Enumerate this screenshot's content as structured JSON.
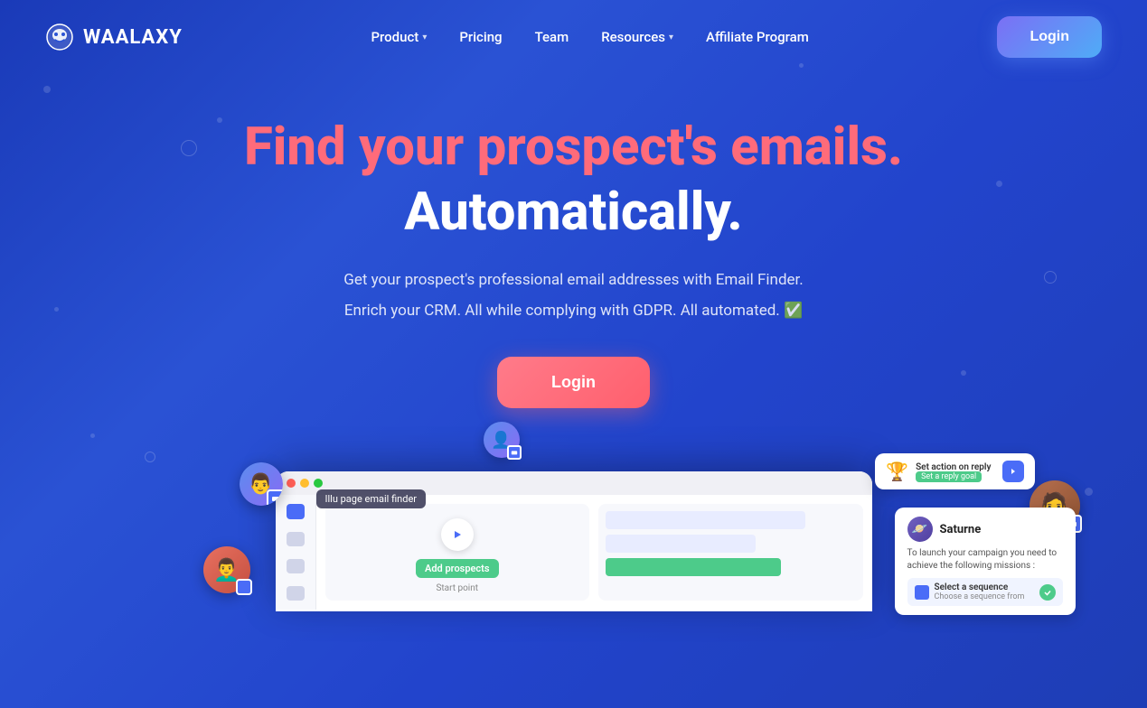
{
  "brand": {
    "name": "WAALAXY",
    "logo_icon": "👾"
  },
  "nav": {
    "items": [
      {
        "label": "Product",
        "has_dropdown": true
      },
      {
        "label": "Pricing",
        "has_dropdown": false
      },
      {
        "label": "Team",
        "has_dropdown": false
      },
      {
        "label": "Resources",
        "has_dropdown": true
      },
      {
        "label": "Affiliate Program",
        "has_dropdown": false
      }
    ],
    "login_label": "Login"
  },
  "hero": {
    "title_line1": "Find your prospect's emails.",
    "title_line2": "Automatically.",
    "subtitle1": "Get your prospect's professional email addresses with Email Finder.",
    "subtitle2": "Enrich your CRM. All while complying with GDPR. All automated. ✅",
    "cta_label": "Login"
  },
  "app_preview": {
    "illu_badge": "Illu page email finder",
    "add_prospects_btn": "Add prospects",
    "start_point": "Start point",
    "toast": {
      "icon": "🏆",
      "line1": "Set action on reply",
      "line2": "Set a reply goal"
    },
    "saturn_card": {
      "name": "Saturne",
      "desc": "To launch your campaign you need to achieve the following missions :",
      "action": "Select a sequence",
      "action_sub": "Choose a sequence from"
    }
  },
  "colors": {
    "bg_dark": "#1a3ab8",
    "bg_mid": "#2a52d4",
    "accent_pink": "#ff6b7a",
    "accent_blue": "#4a6cf7",
    "accent_green": "#4dcb8a",
    "nav_login_bg": "linear-gradient(135deg, #7b6ff5, #4facf7)"
  }
}
